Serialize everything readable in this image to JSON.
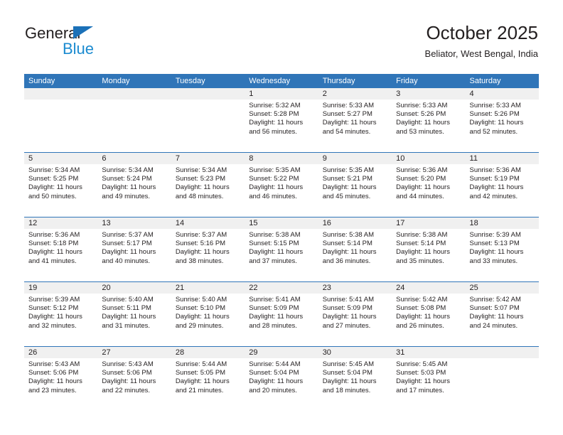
{
  "logo": {
    "word1": "General",
    "word2": "Blue",
    "triangle_icon": "blue-triangle-icon",
    "color_dark": "#231f20",
    "color_blue": "#1b8bd0"
  },
  "header": {
    "title": "October 2025",
    "location": "Beliator, West Bengal, India"
  },
  "theme": {
    "header_blue": "#3075b8",
    "band_gray": "#f0f0f0",
    "text": "#231f20"
  },
  "calendar": {
    "weekday_headers": [
      "Sunday",
      "Monday",
      "Tuesday",
      "Wednesday",
      "Thursday",
      "Friday",
      "Saturday"
    ],
    "labels": {
      "sunrise": "Sunrise:",
      "sunset": "Sunset:",
      "daylight": "Daylight:"
    },
    "weeks": [
      [
        {
          "day": "",
          "sunrise": "",
          "sunset": "",
          "daylight_line1": "",
          "daylight_line2": ""
        },
        {
          "day": "",
          "sunrise": "",
          "sunset": "",
          "daylight_line1": "",
          "daylight_line2": ""
        },
        {
          "day": "",
          "sunrise": "",
          "sunset": "",
          "daylight_line1": "",
          "daylight_line2": ""
        },
        {
          "day": "1",
          "sunrise": "Sunrise: 5:32 AM",
          "sunset": "Sunset: 5:28 PM",
          "daylight_line1": "Daylight: 11 hours",
          "daylight_line2": "and 56 minutes."
        },
        {
          "day": "2",
          "sunrise": "Sunrise: 5:33 AM",
          "sunset": "Sunset: 5:27 PM",
          "daylight_line1": "Daylight: 11 hours",
          "daylight_line2": "and 54 minutes."
        },
        {
          "day": "3",
          "sunrise": "Sunrise: 5:33 AM",
          "sunset": "Sunset: 5:26 PM",
          "daylight_line1": "Daylight: 11 hours",
          "daylight_line2": "and 53 minutes."
        },
        {
          "day": "4",
          "sunrise": "Sunrise: 5:33 AM",
          "sunset": "Sunset: 5:26 PM",
          "daylight_line1": "Daylight: 11 hours",
          "daylight_line2": "and 52 minutes."
        }
      ],
      [
        {
          "day": "5",
          "sunrise": "Sunrise: 5:34 AM",
          "sunset": "Sunset: 5:25 PM",
          "daylight_line1": "Daylight: 11 hours",
          "daylight_line2": "and 50 minutes."
        },
        {
          "day": "6",
          "sunrise": "Sunrise: 5:34 AM",
          "sunset": "Sunset: 5:24 PM",
          "daylight_line1": "Daylight: 11 hours",
          "daylight_line2": "and 49 minutes."
        },
        {
          "day": "7",
          "sunrise": "Sunrise: 5:34 AM",
          "sunset": "Sunset: 5:23 PM",
          "daylight_line1": "Daylight: 11 hours",
          "daylight_line2": "and 48 minutes."
        },
        {
          "day": "8",
          "sunrise": "Sunrise: 5:35 AM",
          "sunset": "Sunset: 5:22 PM",
          "daylight_line1": "Daylight: 11 hours",
          "daylight_line2": "and 46 minutes."
        },
        {
          "day": "9",
          "sunrise": "Sunrise: 5:35 AM",
          "sunset": "Sunset: 5:21 PM",
          "daylight_line1": "Daylight: 11 hours",
          "daylight_line2": "and 45 minutes."
        },
        {
          "day": "10",
          "sunrise": "Sunrise: 5:36 AM",
          "sunset": "Sunset: 5:20 PM",
          "daylight_line1": "Daylight: 11 hours",
          "daylight_line2": "and 44 minutes."
        },
        {
          "day": "11",
          "sunrise": "Sunrise: 5:36 AM",
          "sunset": "Sunset: 5:19 PM",
          "daylight_line1": "Daylight: 11 hours",
          "daylight_line2": "and 42 minutes."
        }
      ],
      [
        {
          "day": "12",
          "sunrise": "Sunrise: 5:36 AM",
          "sunset": "Sunset: 5:18 PM",
          "daylight_line1": "Daylight: 11 hours",
          "daylight_line2": "and 41 minutes."
        },
        {
          "day": "13",
          "sunrise": "Sunrise: 5:37 AM",
          "sunset": "Sunset: 5:17 PM",
          "daylight_line1": "Daylight: 11 hours",
          "daylight_line2": "and 40 minutes."
        },
        {
          "day": "14",
          "sunrise": "Sunrise: 5:37 AM",
          "sunset": "Sunset: 5:16 PM",
          "daylight_line1": "Daylight: 11 hours",
          "daylight_line2": "and 38 minutes."
        },
        {
          "day": "15",
          "sunrise": "Sunrise: 5:38 AM",
          "sunset": "Sunset: 5:15 PM",
          "daylight_line1": "Daylight: 11 hours",
          "daylight_line2": "and 37 minutes."
        },
        {
          "day": "16",
          "sunrise": "Sunrise: 5:38 AM",
          "sunset": "Sunset: 5:14 PM",
          "daylight_line1": "Daylight: 11 hours",
          "daylight_line2": "and 36 minutes."
        },
        {
          "day": "17",
          "sunrise": "Sunrise: 5:38 AM",
          "sunset": "Sunset: 5:14 PM",
          "daylight_line1": "Daylight: 11 hours",
          "daylight_line2": "and 35 minutes."
        },
        {
          "day": "18",
          "sunrise": "Sunrise: 5:39 AM",
          "sunset": "Sunset: 5:13 PM",
          "daylight_line1": "Daylight: 11 hours",
          "daylight_line2": "and 33 minutes."
        }
      ],
      [
        {
          "day": "19",
          "sunrise": "Sunrise: 5:39 AM",
          "sunset": "Sunset: 5:12 PM",
          "daylight_line1": "Daylight: 11 hours",
          "daylight_line2": "and 32 minutes."
        },
        {
          "day": "20",
          "sunrise": "Sunrise: 5:40 AM",
          "sunset": "Sunset: 5:11 PM",
          "daylight_line1": "Daylight: 11 hours",
          "daylight_line2": "and 31 minutes."
        },
        {
          "day": "21",
          "sunrise": "Sunrise: 5:40 AM",
          "sunset": "Sunset: 5:10 PM",
          "daylight_line1": "Daylight: 11 hours",
          "daylight_line2": "and 29 minutes."
        },
        {
          "day": "22",
          "sunrise": "Sunrise: 5:41 AM",
          "sunset": "Sunset: 5:09 PM",
          "daylight_line1": "Daylight: 11 hours",
          "daylight_line2": "and 28 minutes."
        },
        {
          "day": "23",
          "sunrise": "Sunrise: 5:41 AM",
          "sunset": "Sunset: 5:09 PM",
          "daylight_line1": "Daylight: 11 hours",
          "daylight_line2": "and 27 minutes."
        },
        {
          "day": "24",
          "sunrise": "Sunrise: 5:42 AM",
          "sunset": "Sunset: 5:08 PM",
          "daylight_line1": "Daylight: 11 hours",
          "daylight_line2": "and 26 minutes."
        },
        {
          "day": "25",
          "sunrise": "Sunrise: 5:42 AM",
          "sunset": "Sunset: 5:07 PM",
          "daylight_line1": "Daylight: 11 hours",
          "daylight_line2": "and 24 minutes."
        }
      ],
      [
        {
          "day": "26",
          "sunrise": "Sunrise: 5:43 AM",
          "sunset": "Sunset: 5:06 PM",
          "daylight_line1": "Daylight: 11 hours",
          "daylight_line2": "and 23 minutes."
        },
        {
          "day": "27",
          "sunrise": "Sunrise: 5:43 AM",
          "sunset": "Sunset: 5:06 PM",
          "daylight_line1": "Daylight: 11 hours",
          "daylight_line2": "and 22 minutes."
        },
        {
          "day": "28",
          "sunrise": "Sunrise: 5:44 AM",
          "sunset": "Sunset: 5:05 PM",
          "daylight_line1": "Daylight: 11 hours",
          "daylight_line2": "and 21 minutes."
        },
        {
          "day": "29",
          "sunrise": "Sunrise: 5:44 AM",
          "sunset": "Sunset: 5:04 PM",
          "daylight_line1": "Daylight: 11 hours",
          "daylight_line2": "and 20 minutes."
        },
        {
          "day": "30",
          "sunrise": "Sunrise: 5:45 AM",
          "sunset": "Sunset: 5:04 PM",
          "daylight_line1": "Daylight: 11 hours",
          "daylight_line2": "and 18 minutes."
        },
        {
          "day": "31",
          "sunrise": "Sunrise: 5:45 AM",
          "sunset": "Sunset: 5:03 PM",
          "daylight_line1": "Daylight: 11 hours",
          "daylight_line2": "and 17 minutes."
        },
        {
          "day": "",
          "sunrise": "",
          "sunset": "",
          "daylight_line1": "",
          "daylight_line2": ""
        }
      ]
    ]
  }
}
